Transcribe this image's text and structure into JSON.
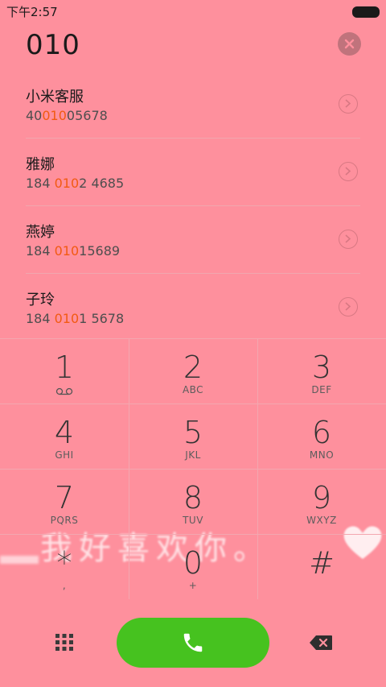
{
  "status_bar": {
    "time": "下午2:57"
  },
  "dialer": {
    "number": "010"
  },
  "results": [
    {
      "name": "小米客服",
      "num_pre": "40",
      "num_match": "010",
      "num_post": "05678"
    },
    {
      "name": "雅娜",
      "num_pre": "184 ",
      "num_match": "010",
      "num_post": "2 4685"
    },
    {
      "name": "燕婷",
      "num_pre": "184 ",
      "num_match": "010",
      "num_post": "15689"
    },
    {
      "name": "子玲",
      "num_pre": "184 ",
      "num_match": "010",
      "num_post": "1 5678"
    }
  ],
  "keys": [
    {
      "digit": "1",
      "letters": ""
    },
    {
      "digit": "2",
      "letters": "ABC"
    },
    {
      "digit": "3",
      "letters": "DEF"
    },
    {
      "digit": "4",
      "letters": "GHI"
    },
    {
      "digit": "5",
      "letters": "JKL"
    },
    {
      "digit": "6",
      "letters": "MNO"
    },
    {
      "digit": "7",
      "letters": "PQRS"
    },
    {
      "digit": "8",
      "letters": "TUV"
    },
    {
      "digit": "9",
      "letters": "WXYZ"
    },
    {
      "digit": "*",
      "letters": ","
    },
    {
      "digit": "0",
      "letters": "+"
    },
    {
      "digit": "#",
      "letters": ""
    }
  ],
  "wallpaper_text": "我好喜欢你。",
  "colors": {
    "background": "#fe909d",
    "highlight": "#f25a12",
    "call_button": "#46c21f"
  },
  "icons": {
    "clear": "clear-circle-x-icon",
    "contact_detail": "chevron-right-circle-icon",
    "voicemail": "voicemail-icon",
    "dialpad": "dialpad-grid-icon",
    "call": "phone-handset-icon",
    "backspace": "backspace-icon"
  }
}
